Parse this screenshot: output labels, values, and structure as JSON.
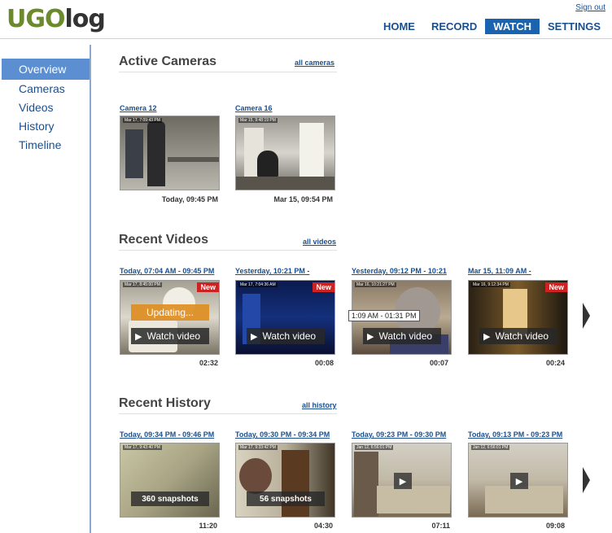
{
  "header": {
    "logo_part1": "UGO",
    "logo_part2": "log",
    "sign_out": "Sign out",
    "nav": [
      "HOME",
      "RECORD",
      "WATCH",
      "SETTINGS"
    ],
    "active_nav": "WATCH"
  },
  "sidebar": {
    "items": [
      "Overview",
      "Cameras",
      "Videos",
      "History",
      "Timeline"
    ],
    "active": "Overview"
  },
  "active_cameras": {
    "title": "Active Cameras",
    "link": "all cameras",
    "cards": [
      {
        "title": "Camera 12",
        "stamp": "Mar 17, 7:09:43 PM",
        "caption": "Today, 09:45 PM"
      },
      {
        "title": "Camera 16",
        "stamp": "Mar 15, 9:48:19 PM",
        "caption": "Mar 15, 09:54 PM"
      }
    ]
  },
  "recent_videos": {
    "title": "Recent Videos",
    "link": "all videos",
    "cards": [
      {
        "title": "Today, 07:04 AM - 09:45 PM",
        "stamp": "Mar 17, 8:45:00 PM",
        "new": "New",
        "updating": "Updating...",
        "button": "Watch video",
        "caption": "02:32"
      },
      {
        "title": "Yesterday, 10:21 PM -",
        "stamp": "Mar 17, 7:04:36 AM",
        "new": "New",
        "button": "Watch video",
        "caption": "00:08"
      },
      {
        "title": "Yesterday, 09:12 PM - 10:21",
        "stamp": "Mar 16, 10:21:27 PM",
        "tooltip": "1:09 AM - 01:31 PM",
        "button": "Watch video",
        "caption": "00:07"
      },
      {
        "title": "Mar 15, 11:09 AM -",
        "stamp": "Mar 16, 9:12:34 PM",
        "new": "New",
        "button": "Watch video",
        "caption": "00:24"
      }
    ]
  },
  "recent_history": {
    "title": "Recent History",
    "link": "all history",
    "cards": [
      {
        "title": "Today, 09:34 PM - 09:46 PM",
        "stamp": "Mar 17, 9:43:40 PM",
        "snapshots": "360 snapshots",
        "caption": "11:20"
      },
      {
        "title": "Today, 09:30 PM - 09:34 PM",
        "stamp": "Mar 17, 9:33:42 PM",
        "snapshots": "56 snapshots",
        "caption": "04:30"
      },
      {
        "title": "Today, 09:23 PM - 09:30 PM",
        "stamp": "Jan 12, 6:56:01 PM",
        "caption": "07:11"
      },
      {
        "title": "Today, 09:13 PM - 09:23 PM",
        "stamp": "Jan 12, 6:56:01 PM",
        "caption": "09:08"
      }
    ]
  }
}
